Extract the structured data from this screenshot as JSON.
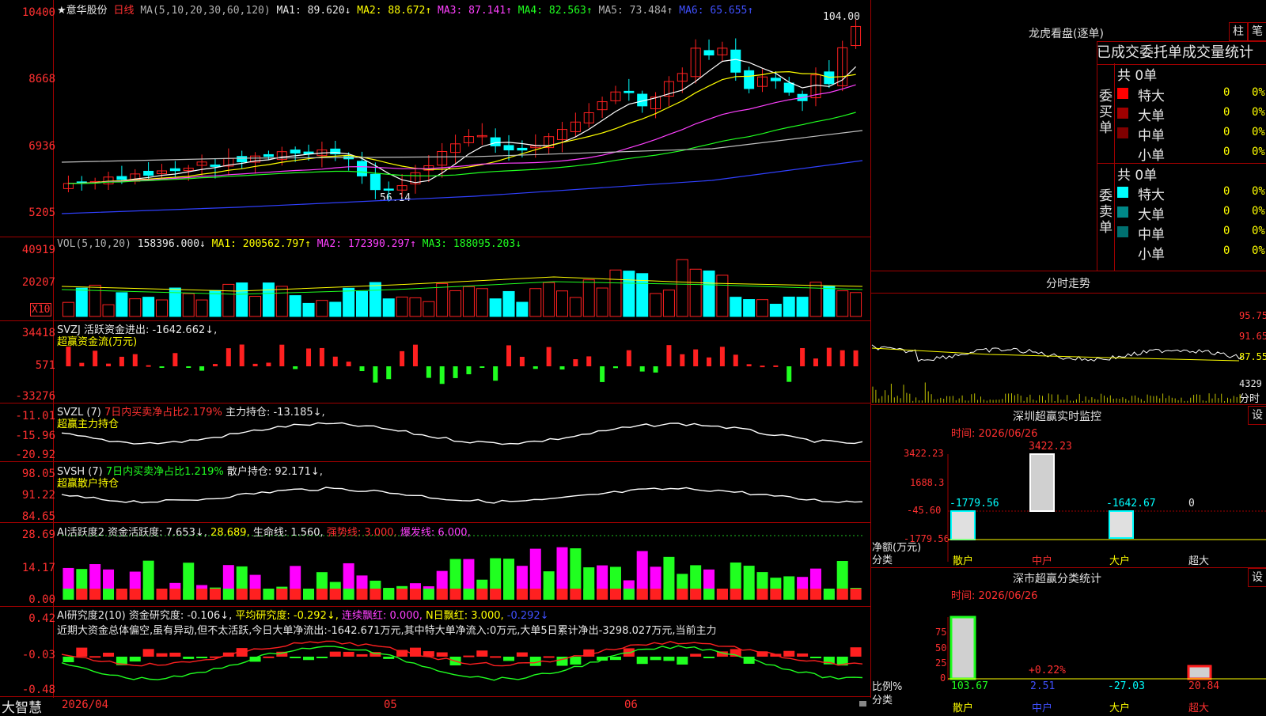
{
  "main": {
    "header": {
      "stock_name": "★意华股份",
      "period": "日线",
      "ma_label": "MA(5,10,20,30,60,120)",
      "ma1": "MA1: 89.620↓",
      "ma2": "MA2: 88.672↑",
      "ma3": "MA3: 87.141↑",
      "ma4": "MA4: 82.563↑",
      "ma5": "MA5: 73.484↑",
      "ma6": "MA6: 65.655↑"
    },
    "y_ticks": [
      "10400",
      "8668",
      "6936",
      "5205"
    ],
    "high_label": "104.00",
    "low_label": "56.14"
  },
  "vol": {
    "header": "VOL(5,10,20)",
    "value": "158396.000↓",
    "ma1": "MA1: 200562.797↑",
    "ma2": "MA2: 172390.297↑",
    "ma3": "MA3: 188095.203↓",
    "y_ticks": [
      "40919",
      "20207"
    ],
    "unit": "X10"
  },
  "svzj": {
    "header": "SVZJ  活跃资金进出: -1642.662↓,",
    "sub": "超赢资金流(万元)",
    "y_ticks": [
      "34418",
      "571",
      "-33276"
    ]
  },
  "svzl": {
    "header": "SVZL (7)",
    "pct": "7日内买卖净占比2.179%",
    "value": "主力持仓: -13.185↓,",
    "sub": "超赢主力持仓",
    "y_ticks": [
      "-11.01",
      "-15.96",
      "-20.92"
    ]
  },
  "svsh": {
    "header": "SVSH (7)",
    "pct": "7日内买卖净占比1.219%",
    "value": "散户持仓: 92.171↓,",
    "sub": "超赢散户持仓",
    "y_ticks": [
      "98.05",
      "91.22",
      "84.65"
    ]
  },
  "ai": {
    "header": "AI活跃度2",
    "v1": "资金活跃度: 7.653↓,",
    "v2": "28.689,",
    "v3": "生命线: 1.560,",
    "v4": "强势线: 3.000,",
    "v5": "爆发线: 6.000,",
    "y_ticks": [
      "28.69",
      "14.17",
      "0.00"
    ]
  },
  "ai2": {
    "header": "AI研究度2(10)",
    "v1": "资金研究度: -0.106↓,",
    "v2": "平均研究度: -0.292↓,",
    "v3": "连续飘红: 0.000,",
    "v4": "N日飘红: 3.000,",
    "v5": "-0.292↓",
    "text": "近期大资金总体偏空,虽有异动,但不太活跃,今日大单净流出:-1642.671万元,其中特大单净流入:0万元,大单5日累计净出-3298.027万元,当前主力",
    "y_ticks": [
      "0.42",
      "-0.03",
      "-0.48"
    ]
  },
  "footer": {
    "brand": "大智慧",
    "dates": [
      "2026/04",
      "05",
      "06"
    ]
  },
  "right": {
    "lhb_title": "龙虎看盘(逐单)",
    "btn1": "柱",
    "btn2": "笔",
    "tabs": [
      "已成交",
      "委托单",
      "成交量统计"
    ],
    "buy_label": "委买单",
    "sell_label": "委卖单",
    "buy_total": "共 0单",
    "sell_total": "共 0单",
    "buy_rows": [
      {
        "name": "特大",
        "count": "0",
        "pct": "0%",
        "color": "#ff0000"
      },
      {
        "name": "大单",
        "count": "0",
        "pct": "0%",
        "color": "#a00000"
      },
      {
        "name": "中单",
        "count": "0",
        "pct": "0%",
        "color": "#800000"
      },
      {
        "name": "小单",
        "count": "0",
        "pct": "0%",
        "color": ""
      }
    ],
    "sell_rows": [
      {
        "name": "特大",
        "count": "0",
        "pct": "0%",
        "color": "#00ffff"
      },
      {
        "name": "大单",
        "count": "0",
        "pct": "0%",
        "color": "#008888"
      },
      {
        "name": "中单",
        "count": "0",
        "pct": "0%",
        "color": "#007070"
      },
      {
        "name": "小单",
        "count": "0",
        "pct": "0%",
        "color": ""
      }
    ],
    "fs_title": "分时走势",
    "fs_ticks": [
      "95.75",
      "91.65",
      "87.55"
    ],
    "fs_vol": "4329",
    "fs_vol_label": "分时",
    "sz_title": "深圳超赢实时监控",
    "sz_set": "设",
    "sz_time": "时间: 2026/06/26",
    "sz_yticks": [
      "3422.23",
      "1688.3",
      "-45.60",
      "-1779.56"
    ],
    "sz_vals": [
      "-1779.56",
      "3422.23",
      "-1642.67",
      "0"
    ],
    "sz_ylabel": "净额(万元)",
    "sz_xlabel": "分类",
    "sz_cats": [
      "散户",
      "中户",
      "大户",
      "超大"
    ],
    "ss_title": "深市超赢分类统计",
    "ss_set": "设",
    "ss_time": "时间: 2026/06/26",
    "ss_yticks": [
      "75",
      "50",
      "25",
      "0"
    ],
    "ss_ylabel": "比例%",
    "ss_xlabel": "分类",
    "ss_vals": [
      "103.67",
      "2.51",
      "-27.03",
      "20.84"
    ],
    "ss_note": "+0.22%",
    "ss_cats": [
      "散户",
      "中户",
      "大户",
      "超大"
    ]
  },
  "colors": {
    "grid": "#a00000",
    "up": "#ff2020",
    "down": "#00ffff",
    "ma1": "#ffffff",
    "ma2": "#ffff00",
    "ma3": "#ff40ff",
    "ma4": "#20ff20",
    "ma5": "#c0c0c0",
    "ma6": "#3040ff"
  }
}
